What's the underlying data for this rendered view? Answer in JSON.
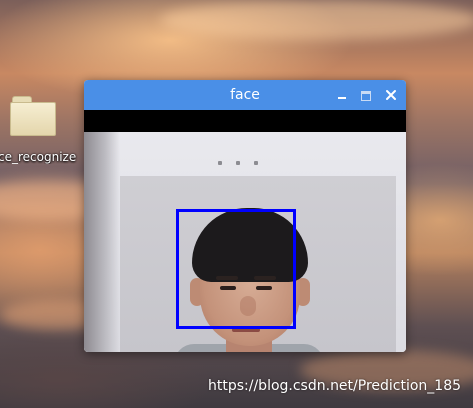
{
  "desktop": {
    "folder_label": "ce_recognize"
  },
  "window": {
    "title": "face",
    "titlebar_color": "#4a8fe7",
    "buttons": {
      "minimize_icon": "minimize-icon",
      "maximize_icon": "maximize-icon",
      "close_icon": "close-icon"
    }
  },
  "detection": {
    "box_color": "#0000ff"
  },
  "watermark": {
    "text": "https://blog.csdn.net/Prediction_185"
  }
}
